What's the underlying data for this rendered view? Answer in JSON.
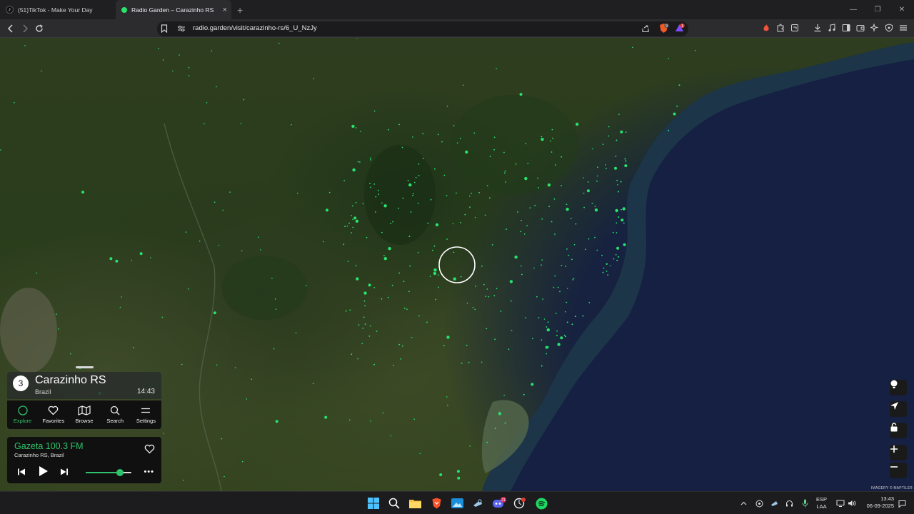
{
  "browser": {
    "tabs": [
      {
        "title": "(51)TikTok - Make Your Day",
        "favicon": "tiktok-icon",
        "active": false
      },
      {
        "title": "Radio Garden – Carazinho RS",
        "favicon": "radio-garden-dot-icon",
        "active": true
      }
    ],
    "new_tab_label": "+",
    "url": "radio.garden/visit/carazinho-rs/6_U_NzJy",
    "brave_shield_badge": "9",
    "rewards_badge": "1"
  },
  "map": {
    "credit": "IMAGERY © MAPTILER",
    "controls": [
      {
        "name": "balloon-icon"
      },
      {
        "name": "locate-icon"
      },
      {
        "name": "lock-icon"
      },
      {
        "name": "zoom-in-icon"
      },
      {
        "name": "zoom-out-icon"
      }
    ]
  },
  "place": {
    "count": "3",
    "name": "Carazinho RS",
    "country": "Brazil",
    "local_time": "14:43"
  },
  "nav": {
    "items": [
      {
        "label": "Explore",
        "icon": "explore-circle-icon",
        "active": true
      },
      {
        "label": "Favorites",
        "icon": "heart-icon",
        "active": false
      },
      {
        "label": "Browse",
        "icon": "map-icon",
        "active": false
      },
      {
        "label": "Search",
        "icon": "search-icon",
        "active": false
      },
      {
        "label": "Settings",
        "icon": "menu-icon",
        "active": false
      }
    ]
  },
  "player": {
    "station": "Gazeta 100.3 FM",
    "location": "Carazinho RS, Brazil",
    "volume_fraction": 0.75,
    "more_label": "•••"
  },
  "taskbar": {
    "apps": [
      "windows-start-icon",
      "search-icon",
      "file-explorer-icon",
      "brave-browser-icon",
      "photos-icon",
      "steam-icon",
      "discord-icon",
      "opera-gx-icon",
      "spotify-icon"
    ],
    "discord_badge": "21",
    "language_line1": "ESP",
    "language_line2": "LAA",
    "time": "13:43",
    "date": "06-09-2025"
  },
  "colors": {
    "accent_green": "#2ec36b",
    "station_dot": "#27e36d",
    "ocean": "#141c3a"
  }
}
